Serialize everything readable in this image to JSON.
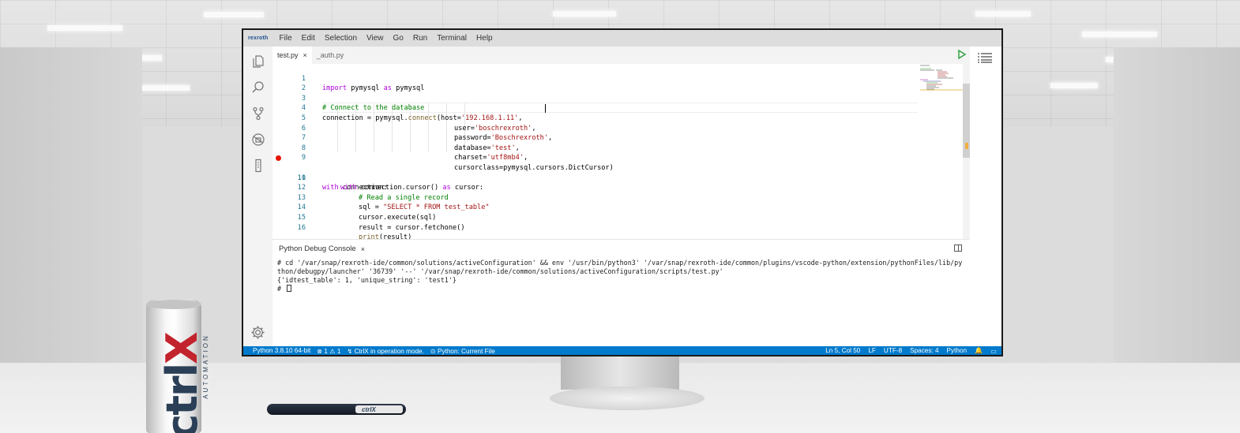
{
  "menubar": {
    "brand": "rexroth",
    "items": [
      "File",
      "Edit",
      "Selection",
      "View",
      "Go",
      "Run",
      "Terminal",
      "Help"
    ]
  },
  "activitybar": {
    "icons": [
      "explorer-icon",
      "search-icon",
      "source-control-icon",
      "debug-icon",
      "extensions-icon",
      "settings-gear-icon"
    ]
  },
  "tabs": [
    {
      "label": "test.py",
      "close": "×",
      "active": true
    },
    {
      "label": "_auth.py",
      "close": "",
      "active": false
    }
  ],
  "editor": {
    "lines": [
      {
        "n": "1"
      },
      {
        "n": "2"
      },
      {
        "n": "3"
      },
      {
        "n": "4"
      },
      {
        "n": "5"
      },
      {
        "n": "6"
      },
      {
        "n": "7"
      },
      {
        "n": "8"
      },
      {
        "n": "9"
      },
      {
        "n": "10"
      },
      {
        "n": "11"
      },
      {
        "n": "12"
      },
      {
        "n": "13"
      },
      {
        "n": "14"
      },
      {
        "n": "15"
      },
      {
        "n": "16"
      }
    ],
    "code": {
      "l1_kw": "import",
      "l1_a": " pymysql ",
      "l1_as": "as",
      "l1_b": " pymysql",
      "l3": "# Connect to the database",
      "l4_a": "connection = pymysql.",
      "l4_fn": "connect",
      "l4_b": "(host=",
      "l4_s": "'192.168.1.11'",
      "l4_c": ",",
      "l5_a": "user=",
      "l5_s": "'boschrexroth'",
      "l5_c": ",",
      "l6_a": "password=",
      "l6_s": "'Boschrexroth'",
      "l6_c": ",",
      "l7_a": "database=",
      "l7_s": "'test'",
      "l7_c": ",",
      "l8_a": "charset=",
      "l8_s": "'utf8mb4'",
      "l8_c": ",",
      "l9_a": "cursorclass=pymysql.cursors.DictCursor)",
      "l10_kw": "with",
      "l10_a": " connection:",
      "l11_kw": "with",
      "l11_a": " connection.cursor() ",
      "l11_as": "as",
      "l11_b": " cursor:",
      "l12": "# Read a single record",
      "l13_a": "sql = ",
      "l13_s": "\"SELECT * FROM test_table\"",
      "l14": "cursor.execute(sql)",
      "l15": "result = cursor.fetchone()",
      "l16_fn": "print",
      "l16_a": "(result)"
    }
  },
  "panel": {
    "title": "Python Debug Console",
    "close": "×",
    "output": [
      "# cd '/var/snap/rexroth-ide/common/solutions/activeConfiguration' && env '/usr/bin/python3' '/var/snap/rexroth-ide/common/plugins/vscode-python/extension/pythonFiles/lib/python/debugpy/launcher' '36739' '--' '/var/snap/rexroth-ide/common/solutions/activeConfiguration/scripts/test.py'",
      "{'idtest_table': 1, 'unique_string': 'test1'}",
      "# "
    ]
  },
  "statusbar": {
    "interpreter": "Python 3.8.10 64-bit",
    "problems": "⊗ 1 ⚠ 1",
    "mode": "↯ CtrlX in operation mode.",
    "debug_config": "⊙ Python: Current File",
    "position": "Ln 5, Col 50",
    "eol": "LF",
    "encoding": "UTF-8",
    "indent": "Spaces: 4",
    "language": "Python",
    "bell": "🔔",
    "layout": "▭"
  },
  "props": {
    "can_logo": "ctrlX",
    "can_sub": "AUTOMATION",
    "pen_label": "ctrlX"
  },
  "colors": {
    "statusbar": "#007acc",
    "breakpoint": "#e51400",
    "keyword": "#af00db",
    "string": "#a31515",
    "comment": "#008000"
  }
}
